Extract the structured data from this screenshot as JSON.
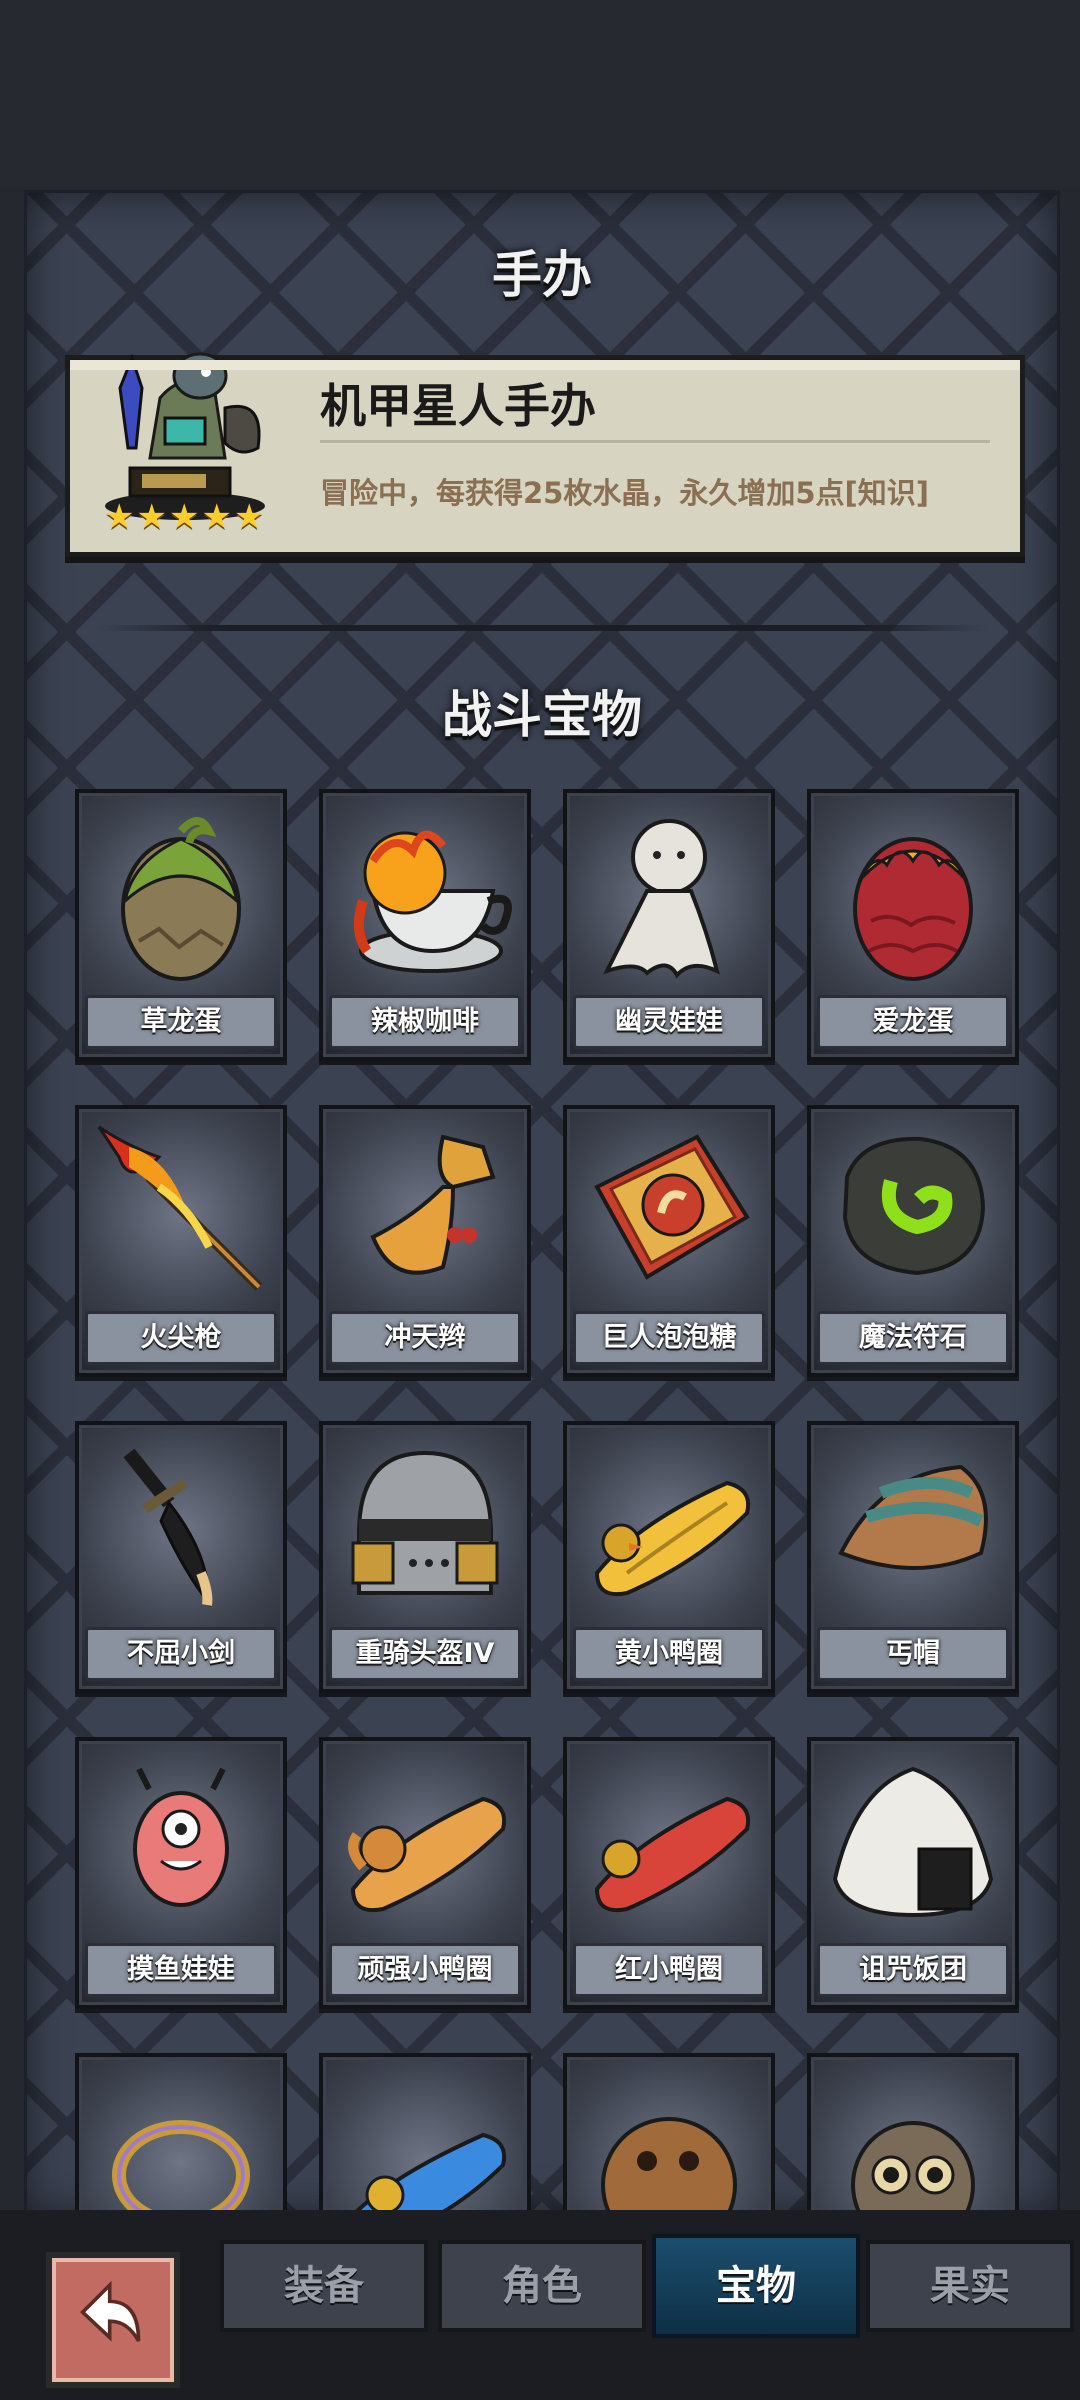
{
  "figurine_section": {
    "title": "手办",
    "figurine": {
      "name": "机甲星人手办",
      "description": "冒险中，每获得25枚水晶，永久增加5点[知识]",
      "stars": 5,
      "icon": "mech-alien-figurine-icon"
    }
  },
  "combat_section": {
    "title": "战斗宝物",
    "items": [
      {
        "label": "草龙蛋",
        "icon": "grass-dragon-egg-icon"
      },
      {
        "label": "辣椒咖啡",
        "icon": "chili-coffee-icon"
      },
      {
        "label": "幽灵娃娃",
        "icon": "ghost-doll-icon"
      },
      {
        "label": "爱龙蛋",
        "icon": "love-dragon-egg-icon"
      },
      {
        "label": "火尖枪",
        "icon": "fire-spear-icon"
      },
      {
        "label": "冲天辫",
        "icon": "pigtail-icon"
      },
      {
        "label": "巨人泡泡糖",
        "icon": "giant-bubblegum-icon"
      },
      {
        "label": "魔法符石",
        "icon": "magic-rune-stone-icon"
      },
      {
        "label": "不屈小剑",
        "icon": "unyielding-sword-icon"
      },
      {
        "label": "重骑头盔IV",
        "icon": "knight-helmet-icon"
      },
      {
        "label": "黄小鸭圈",
        "icon": "yellow-duck-ring-icon"
      },
      {
        "label": "丐帽",
        "icon": "beggar-hat-icon"
      },
      {
        "label": "摸鱼娃娃",
        "icon": "slacker-doll-icon"
      },
      {
        "label": "顽强小鸭圈",
        "icon": "tough-duck-ring-icon"
      },
      {
        "label": "红小鸭圈",
        "icon": "red-duck-ring-icon"
      },
      {
        "label": "诅咒饭团",
        "icon": "cursed-rice-ball-icon"
      },
      {
        "label": "",
        "icon": "rainbow-ring-icon"
      },
      {
        "label": "",
        "icon": "blue-duck-ring-icon"
      },
      {
        "label": "",
        "icon": "bronze-pot-icon"
      },
      {
        "label": "",
        "icon": "owl-icon"
      }
    ]
  },
  "bottom_nav": {
    "back_icon": "back-arrow-icon",
    "tabs": [
      {
        "label": "装备",
        "active": false
      },
      {
        "label": "角色",
        "active": false
      },
      {
        "label": "宝物",
        "active": true
      },
      {
        "label": "果实",
        "active": false
      }
    ]
  }
}
